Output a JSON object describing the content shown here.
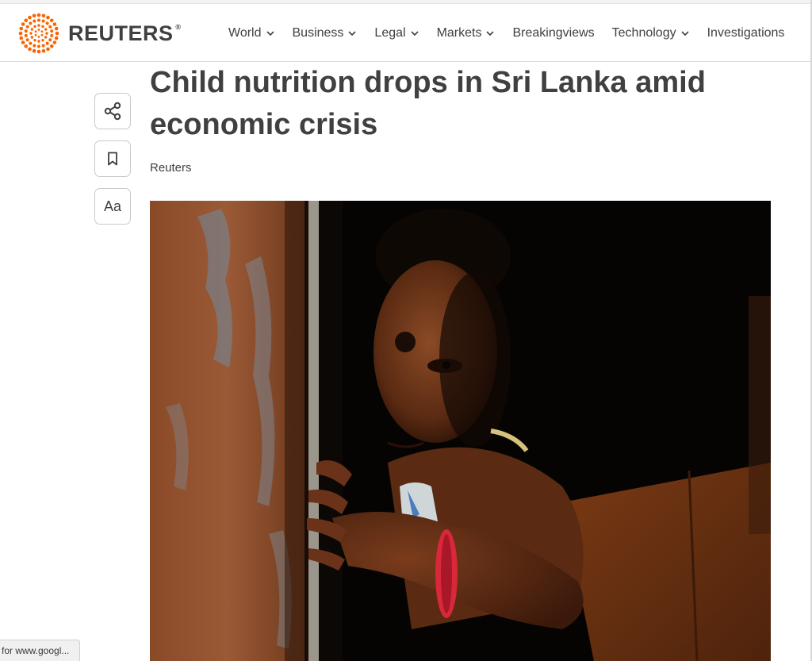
{
  "header": {
    "logo_text": "REUTERS",
    "logo_registered": "®",
    "nav": [
      {
        "label": "World",
        "has_dropdown": true
      },
      {
        "label": "Business",
        "has_dropdown": true
      },
      {
        "label": "Legal",
        "has_dropdown": true
      },
      {
        "label": "Markets",
        "has_dropdown": true
      },
      {
        "label": "Breakingviews",
        "has_dropdown": false
      },
      {
        "label": "Technology",
        "has_dropdown": true
      },
      {
        "label": "Investigations",
        "has_dropdown": false
      }
    ]
  },
  "tools": {
    "share_icon": "share-icon",
    "bookmark_icon": "bookmark-icon",
    "text_size_label": "Aa"
  },
  "article": {
    "headline": "Child nutrition drops in Sri Lanka amid economic crisis",
    "byline": "Reuters"
  },
  "status_bar": {
    "text": "for www.googl..."
  },
  "colors": {
    "brand_orange": "#fa6400",
    "text": "#404040",
    "border": "#dcdcdc"
  }
}
